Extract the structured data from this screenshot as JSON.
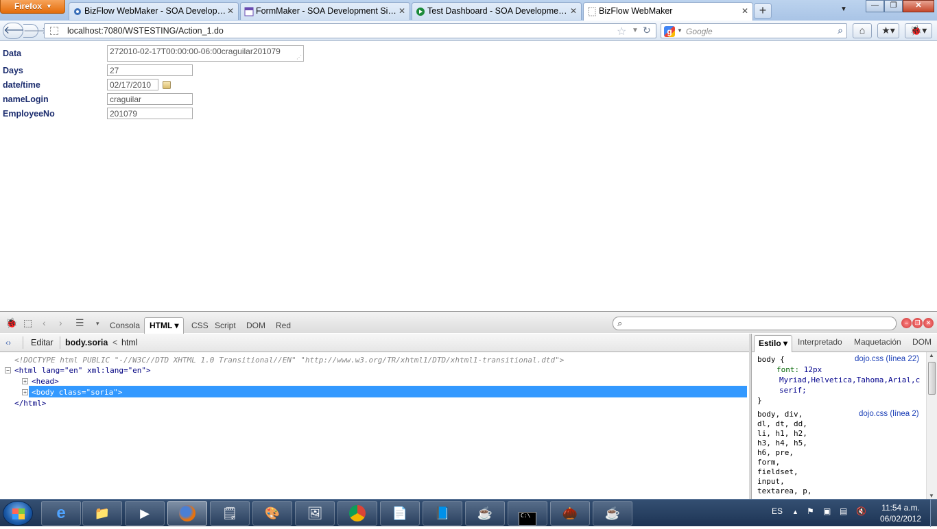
{
  "browser": {
    "app_button": "Firefox",
    "tabs": [
      {
        "label": "BizFlow WebMaker - SOA Developme...",
        "icon": "gear-icon"
      },
      {
        "label": "FormMaker - SOA Development Sim...",
        "icon": "form-icon"
      },
      {
        "label": "Test Dashboard - SOA Development ...",
        "icon": "play-icon"
      },
      {
        "label": "BizFlow WebMaker",
        "icon": "blank-page-icon"
      }
    ],
    "url": "localhost:7080/WSTESTING/Action_1.do",
    "search_placeholder": "Google"
  },
  "form": {
    "fields": [
      {
        "label": "Data",
        "value": "272010-02-17T00:00:00-06:00craguilar201079"
      },
      {
        "label": "Days",
        "value": "27"
      },
      {
        "label": "date/time",
        "value": "02/17/2010"
      },
      {
        "label": "nameLogin",
        "value": "craguilar"
      },
      {
        "label": "EmployeeNo",
        "value": "201079"
      }
    ]
  },
  "firebug": {
    "tabs": [
      "Consola",
      "HTML",
      "CSS",
      "Script",
      "DOM",
      "Red"
    ],
    "active_tab": "HTML",
    "breadcrumb": {
      "edit": "Editar",
      "current": "body.soria",
      "separator": "<",
      "parent": "html"
    },
    "html_tree": {
      "doctype": "<!DOCTYPE html PUBLIC \"-//W3C//DTD XHTML 1.0 Transitional//EN\" \"http://www.w3.org/TR/xhtml1/DTD/xhtml1-transitional.dtd\">",
      "html_open": "<html lang=\"en\" xml:lang=\"en\">",
      "head": "<head>",
      "body": "<body class=\"soria\">",
      "html_close": "</html>"
    },
    "side_tabs": [
      "Estilo",
      "Interpretado",
      "Maquetación",
      "DOM"
    ],
    "styles": {
      "rule1_selector": "body {",
      "rule1_source": "dojo.css (línea 22)",
      "rule1_prop": "font:",
      "rule1_val": "12px",
      "rule1_val2": "Myriad,Helvetica,Tahoma,Arial,c",
      "rule1_val3": "serif;",
      "rule1_close": "}",
      "rule2_source": "dojo.css (línea 2)",
      "rule2_selectors": [
        "body, div,",
        "dl, dt, dd,",
        "li, h1, h2,",
        "h3, h4, h5,",
        "h6, pre,",
        "form,",
        "fieldset,",
        "input,",
        "textarea, p,"
      ]
    }
  },
  "taskbar": {
    "language": "ES",
    "time": "11:54 a.m.",
    "date": "06/02/2012"
  }
}
